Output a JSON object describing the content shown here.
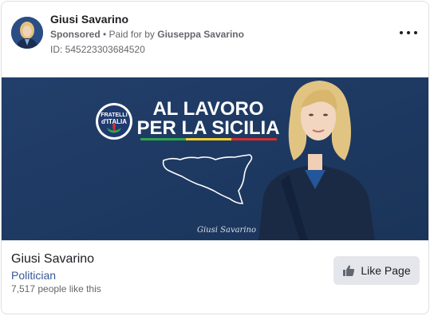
{
  "post_header": {
    "page_name": "Giusi Savarino",
    "sponsored_label": "Sponsored",
    "separator": " • ",
    "paid_for_prefix": "Paid for by ",
    "paid_for_name": "Giuseppa Savarino",
    "ad_id": "ID: 545223303684520"
  },
  "banner": {
    "headline_line1": "AL LAVORO",
    "headline_line2": "PER LA SICILIA",
    "party_logo_line1": "FRATELLI",
    "party_logo_line2": "d'ITALIA",
    "signature": "Giusi Savarino"
  },
  "footer": {
    "page_name": "Giusi Savarino",
    "category": "Politician",
    "likes": "7,517 people like this",
    "like_button_label": "Like Page"
  },
  "icons": {
    "more": "more-horizontal-icon",
    "like": "thumbs-up-icon"
  }
}
